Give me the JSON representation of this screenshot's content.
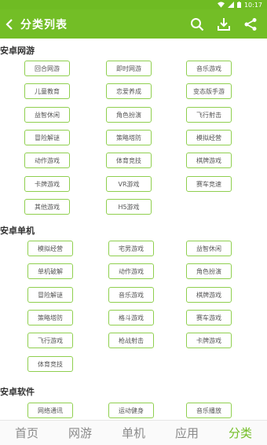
{
  "status": {
    "time": "10:17"
  },
  "appbar": {
    "title": "分类列表"
  },
  "sections": [
    {
      "title": "安卓网游",
      "items": [
        "回合网游",
        "即时网游",
        "音乐游戏",
        "儿童教育",
        "恋爱养成",
        "变态版手游",
        "益智休闲",
        "角色扮演",
        "飞行射击",
        "冒险解谜",
        "策略塔防",
        "模拟经营",
        "动作游戏",
        "体育竞技",
        "棋牌游戏",
        "卡牌游戏",
        "VR游戏",
        "赛车竞速",
        "其他游戏",
        "H5游戏"
      ]
    },
    {
      "title": "安卓单机",
      "items": [
        "模拟经营",
        "宅男游戏",
        "益智休闲",
        "单机破解",
        "动作游戏",
        "角色扮演",
        "冒险解谜",
        "音乐游戏",
        "棋牌游戏",
        "策略塔防",
        "格斗游戏",
        "赛车游戏",
        "飞行游戏",
        "枪战射击",
        "卡牌游戏",
        "体育竞技"
      ]
    },
    {
      "title": "安卓软件",
      "items": [
        "网络通讯",
        "运动健身",
        "音乐播放"
      ]
    }
  ],
  "bottom_nav": [
    "首页",
    "网游",
    "单机",
    "应用",
    "分类"
  ],
  "colors": {
    "accent": "#73be26",
    "tag_border": "#8fcf4e"
  }
}
